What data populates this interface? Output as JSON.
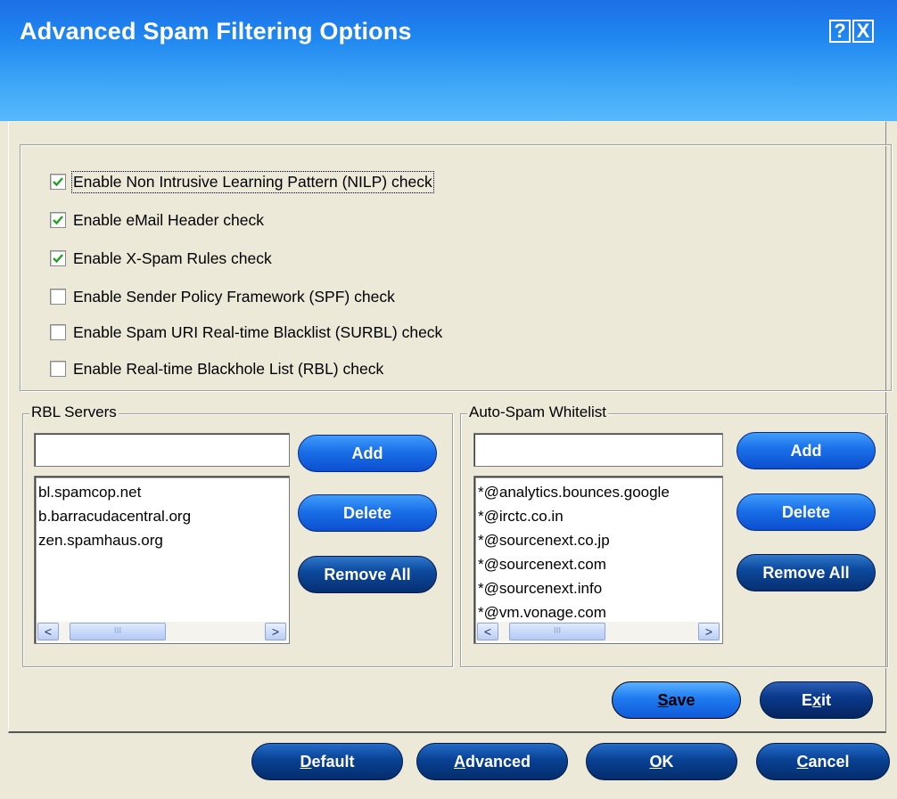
{
  "window": {
    "title": "Advanced Spam Filtering Options",
    "help_glyph": "?",
    "close_glyph": "X"
  },
  "options": [
    {
      "label": "Enable Non Intrusive Learning Pattern (NILP) check",
      "checked": true
    },
    {
      "label": "Enable eMail Header check",
      "checked": true
    },
    {
      "label": "Enable X-Spam Rules check",
      "checked": true
    },
    {
      "label": "Enable Sender Policy Framework (SPF) check",
      "checked": false
    },
    {
      "label": "Enable Spam URI Real-time Blacklist (SURBL) check",
      "checked": false
    },
    {
      "label": "Enable Real-time Blackhole List (RBL) check",
      "checked": false
    }
  ],
  "rbl": {
    "legend": "RBL Servers",
    "input_value": "",
    "items": [
      "bl.spamcop.net",
      "b.barracudacentral.org",
      "zen.spamhaus.org"
    ],
    "add": "Add",
    "delete": "Delete",
    "remove_all": "Remove All"
  },
  "whitelist": {
    "legend": "Auto-Spam Whitelist",
    "input_value": "",
    "items": [
      "*@analytics.bounces.google",
      "*@irctc.co.in",
      "*@sourcenext.co.jp",
      "*@sourcenext.com",
      "*@sourcenext.info",
      "*@vm.vonage.com"
    ],
    "add": "Add",
    "delete": "Delete",
    "remove_all": "Remove All"
  },
  "scroll": {
    "left": "<",
    "right": ">",
    "grip": "III"
  },
  "actions": {
    "save": {
      "key": "S",
      "rest": "ave"
    },
    "exit": {
      "pre": "E",
      "key": "x",
      "rest": "it"
    }
  },
  "footer": {
    "default": {
      "key": "D",
      "rest": "efault"
    },
    "advanced": {
      "key": "A",
      "rest": "dvanced"
    },
    "ok": {
      "key": "O",
      "rest": "K"
    },
    "cancel": {
      "key": "C",
      "rest": "ancel"
    }
  },
  "colors": {
    "header_top": "#1d6fe6",
    "header_bottom": "#56b9fb",
    "button_blue": "#1a6fe8",
    "button_navy": "#0b3a8c",
    "check_green": "#21a121"
  }
}
